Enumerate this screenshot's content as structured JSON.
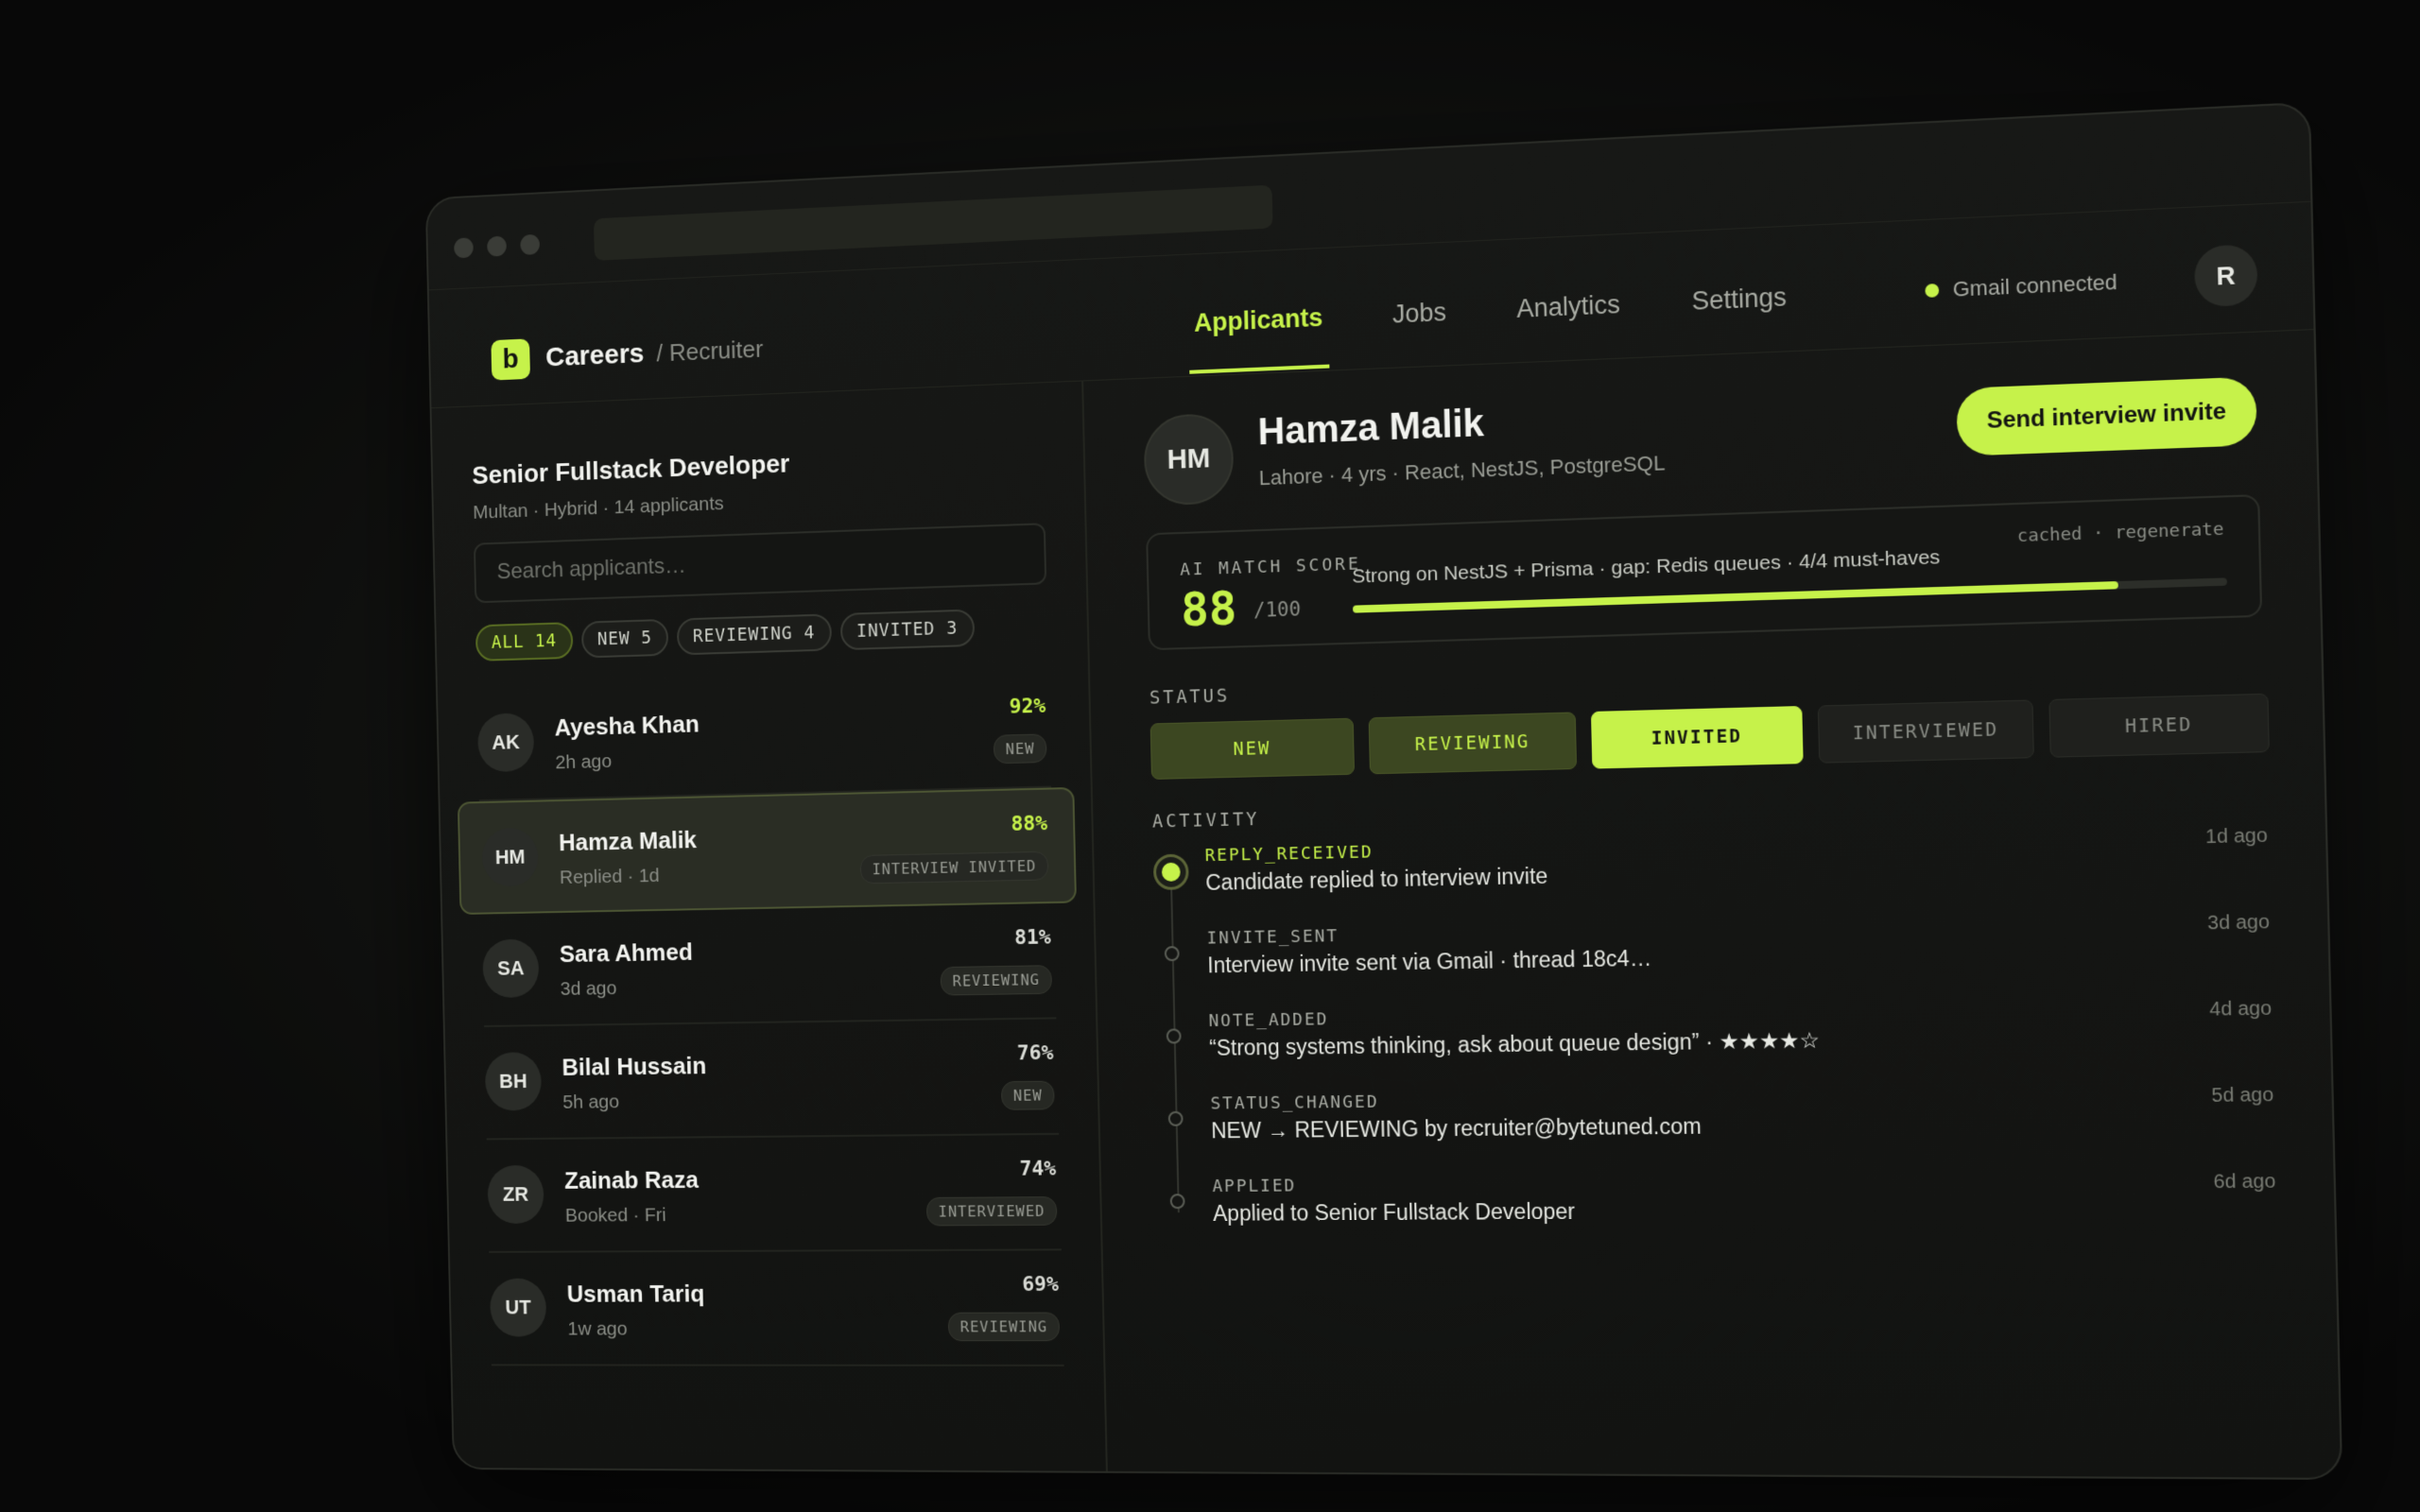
{
  "nav": {
    "brand_letter": "b",
    "brand_name": "Careers",
    "brand_sub": "/ Recruiter",
    "tabs": [
      "Applicants",
      "Jobs",
      "Analytics",
      "Settings"
    ],
    "gmail_status": "Gmail connected",
    "user_initial": "R"
  },
  "job": {
    "title": "Senior Fullstack Developer",
    "meta": "Multan · Hybrid · 14 applicants",
    "search_placeholder": "Search applicants…",
    "filters": [
      "ALL 14",
      "NEW 5",
      "REVIEWING 4",
      "INVITED 3"
    ]
  },
  "applicants": [
    {
      "initials": "AK",
      "name": "Ayesha Khan",
      "sub": "2h ago",
      "score": "92%",
      "badge": "NEW"
    },
    {
      "initials": "HM",
      "name": "Hamza Malik",
      "sub": "Replied · 1d",
      "score": "88%",
      "badge": "INTERVIEW INVITED"
    },
    {
      "initials": "SA",
      "name": "Sara Ahmed",
      "sub": "3d ago",
      "score": "81%",
      "badge": "REVIEWING"
    },
    {
      "initials": "BH",
      "name": "Bilal Hussain",
      "sub": "5h ago",
      "score": "76%",
      "badge": "NEW"
    },
    {
      "initials": "ZR",
      "name": "Zainab Raza",
      "sub": "Booked · Fri",
      "score": "74%",
      "badge": "INTERVIEWED"
    },
    {
      "initials": "UT",
      "name": "Usman Tariq",
      "sub": "1w ago",
      "score": "69%",
      "badge": "REVIEWING"
    }
  ],
  "candidate": {
    "initials": "HM",
    "name": "Hamza Malik",
    "meta": "Lahore · 4 yrs · React, NestJS, PostgreSQL",
    "action": "Send interview invite",
    "match": {
      "label": "AI MATCH SCORE",
      "score": "88",
      "out_of": "/100",
      "fraction": 0.88,
      "summary": "Strong on NestJS + Prisma · gap: Redis queues · 4/4 must-haves",
      "cache_note": "cached · regenerate"
    },
    "status_label": "STATUS",
    "statuses": [
      "NEW",
      "REVIEWING",
      "INVITED",
      "INTERVIEWED",
      "HIRED"
    ],
    "activity_label": "ACTIVITY",
    "activity": [
      {
        "type": "REPLY_RECEIVED",
        "text": "Candidate replied to interview invite",
        "time": "1d ago"
      },
      {
        "type": "INVITE_SENT",
        "text": "Interview invite sent via Gmail · thread 18c4…",
        "time": "3d ago"
      },
      {
        "type": "NOTE_ADDED",
        "text": "“Strong systems thinking, ask about queue design” · ★★★★☆",
        "time": "4d ago"
      },
      {
        "type": "STATUS_CHANGED",
        "text": "NEW → REVIEWING by recruiter@bytetuned.com",
        "time": "5d ago"
      },
      {
        "type": "APPLIED",
        "text": "Applied to Senior Fullstack Developer",
        "time": "6d ago"
      }
    ]
  },
  "colors": {
    "accent": "#c6f24a",
    "background": "#121311"
  }
}
